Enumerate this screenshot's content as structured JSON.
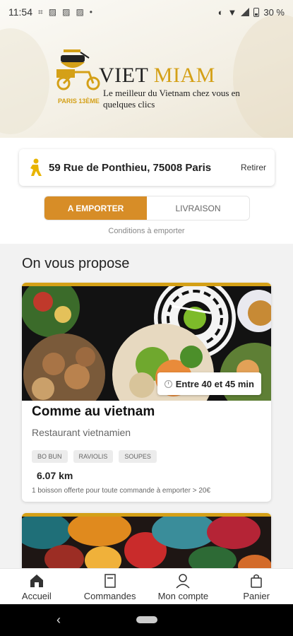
{
  "status_bar": {
    "time": "11:54",
    "left_icons": [
      "grid-icon",
      "photo-icon",
      "photo-icon",
      "photo-icon",
      "dot-icon"
    ],
    "battery": "30 %"
  },
  "brand": {
    "name_part1": "VIET",
    "name_part2": "MIAM",
    "tagline": "Le meilleur du Vietnam chez vous en quelques clics",
    "badge": "PARIS 13ÈME",
    "accent_color": "#d4a017"
  },
  "address": {
    "value": "59 Rue de Ponthieu, 75008 Paris",
    "action": "Retirer"
  },
  "mode_toggle": {
    "options": [
      "A EMPORTER",
      "LIVRAISON"
    ],
    "selected": "A EMPORTER",
    "accent_color": "#d78d27"
  },
  "conditions_link": "Conditions à emporter",
  "section": {
    "title": "On vous propose"
  },
  "restaurants": [
    {
      "name": "Comme au vietnam",
      "category": "Restaurant vietnamien",
      "time": "Entre 40 et 45 min",
      "tags": [
        "BO BUN",
        "RAVIOLIS",
        "SOUPES"
      ],
      "distance": "6.07 km",
      "promo": "1 boisson offerte pour toute commande à emporter > 20€"
    }
  ],
  "bottom_nav": [
    {
      "label": "Accueil",
      "icon": "home-icon"
    },
    {
      "label": "Commandes",
      "icon": "receipt-icon"
    },
    {
      "label": "Mon compte",
      "icon": "user-icon"
    },
    {
      "label": "Panier",
      "icon": "bag-icon"
    }
  ]
}
